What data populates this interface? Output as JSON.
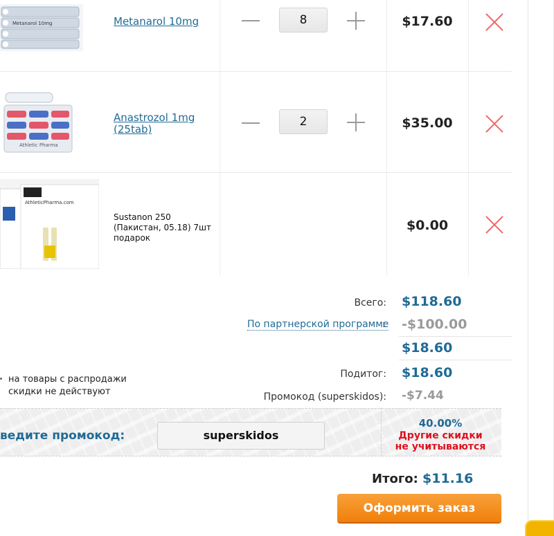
{
  "cart": {
    "items": [
      {
        "name": "Metanarol 10mg",
        "qty": "8",
        "price": "$17.60",
        "image_text": "Metanarol 10mg"
      },
      {
        "name": "Anastrozol 1mg (25tab)",
        "qty": "2",
        "price": "$35.00",
        "image_text": "Athletic Pharma"
      },
      {
        "name": "Sustanon 250 (Пакистан, 05.18) 7шт подарок",
        "qty": "",
        "price": "$0.00",
        "image_text": "AthleticPharma.com"
      }
    ]
  },
  "totals": {
    "total_label": "Всего:",
    "total_value": "$118.60",
    "partner_label": "По партнерской программе",
    "partner_colon": ":",
    "partner_value": "-$100.00",
    "after_partner_value": "$18.60",
    "subtotal_label": "Подитог:",
    "subtotal_value": "$18.60",
    "promo_discount_label": "Промокод (superskidos):",
    "promo_discount_value": "-$7.44"
  },
  "sale_note": {
    "line1": "на товары с распродажи",
    "line2": "скидки не действуют"
  },
  "promo": {
    "label": "ведите промокод:",
    "code_value": "superskidos",
    "percent": "40.00%",
    "warning_line1": "Другие скидки",
    "warning_line2": "не учитываются"
  },
  "summary": {
    "grand_total_label": "Итого:",
    "grand_total_value": "$11.16",
    "checkout_label": "Оформить заказ"
  },
  "colors": {
    "brand_blue": "#1f6a95",
    "remove_red": "#f06666",
    "warning_red": "#e0101e",
    "checkout_orange": "#f39017"
  }
}
